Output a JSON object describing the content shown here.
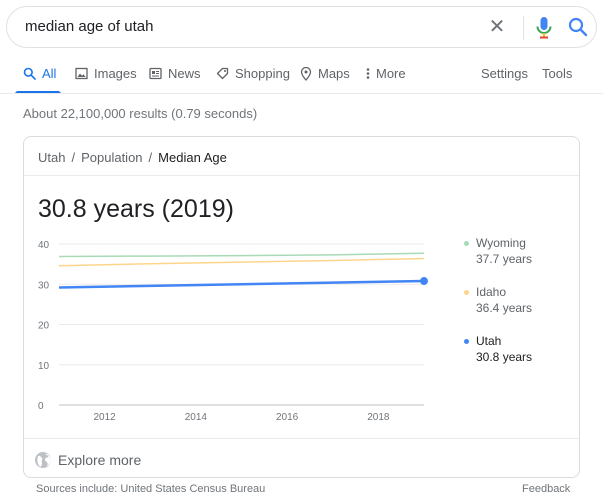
{
  "search": {
    "query": "median age of utah"
  },
  "tabs": [
    {
      "label": "All"
    },
    {
      "label": "Images"
    },
    {
      "label": "News"
    },
    {
      "label": "Shopping"
    },
    {
      "label": "Maps"
    },
    {
      "label": "More"
    }
  ],
  "tools": {
    "settings": "Settings",
    "tools": "Tools"
  },
  "result_stats": "About 22,100,000 results (0.79 seconds)",
  "card": {
    "breadcrumb": [
      "Utah",
      "Population",
      "Median Age"
    ],
    "headline": "30.8 years (2019)",
    "explore_more": "Explore more",
    "legend": [
      {
        "name": "Wyoming",
        "value": "37.7 years"
      },
      {
        "name": "Idaho",
        "value": "36.4 years"
      },
      {
        "name": "Utah",
        "value": "30.8 years"
      }
    ]
  },
  "footer": {
    "sources": "Sources include: United States Census Bureau",
    "feedback": "Feedback"
  },
  "colors": {
    "accent": "#1a73e8",
    "wyoming": "#a8dab5",
    "idaho": "#fdd58a",
    "utah": "#4285f4"
  },
  "chart_data": {
    "type": "line",
    "xlim": [
      2011,
      2019
    ],
    "ylim": [
      0,
      40
    ],
    "x_ticks": [
      2012,
      2014,
      2016,
      2018
    ],
    "y_ticks": [
      0,
      10,
      20,
      30,
      40
    ],
    "grid": true,
    "legend_position": "right",
    "series": [
      {
        "name": "Wyoming",
        "x": [
          2011,
          2013,
          2015,
          2017,
          2019
        ],
        "values": [
          36.9,
          37.0,
          37.1,
          37.3,
          37.7
        ],
        "color": "#a8dab5"
      },
      {
        "name": "Idaho",
        "x": [
          2011,
          2013,
          2015,
          2017,
          2019
        ],
        "values": [
          34.6,
          35.1,
          35.5,
          35.9,
          36.4
        ],
        "color": "#fdd58a"
      },
      {
        "name": "Utah",
        "x": [
          2011,
          2013,
          2015,
          2017,
          2019
        ],
        "values": [
          29.2,
          29.6,
          30.0,
          30.4,
          30.8
        ],
        "color": "#4285f4"
      }
    ]
  }
}
